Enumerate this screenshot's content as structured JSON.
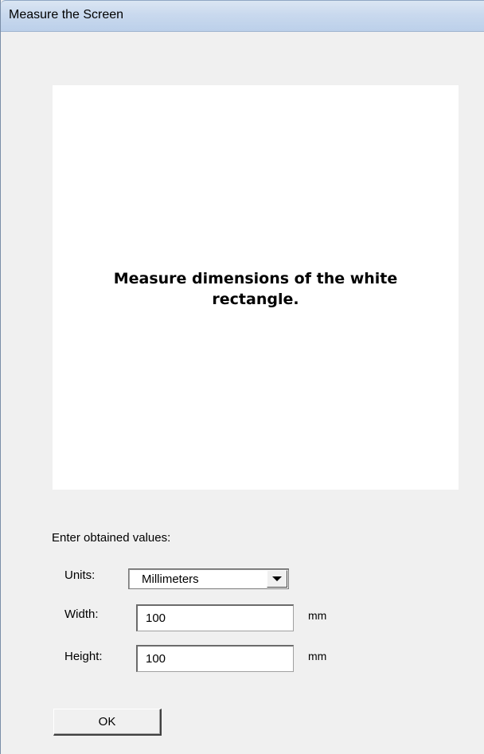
{
  "window": {
    "title": "Measure the Screen"
  },
  "preview": {
    "message": "Measure dimensions of the white rectangle."
  },
  "form": {
    "instructions": "Enter obtained values:",
    "units_label": "Units:",
    "units_value": "Millimeters",
    "width_label": "Width:",
    "width_value": "100",
    "width_unit": "mm",
    "height_label": "Height:",
    "height_value": "100",
    "height_unit": "mm"
  },
  "buttons": {
    "ok_label": "OK"
  }
}
